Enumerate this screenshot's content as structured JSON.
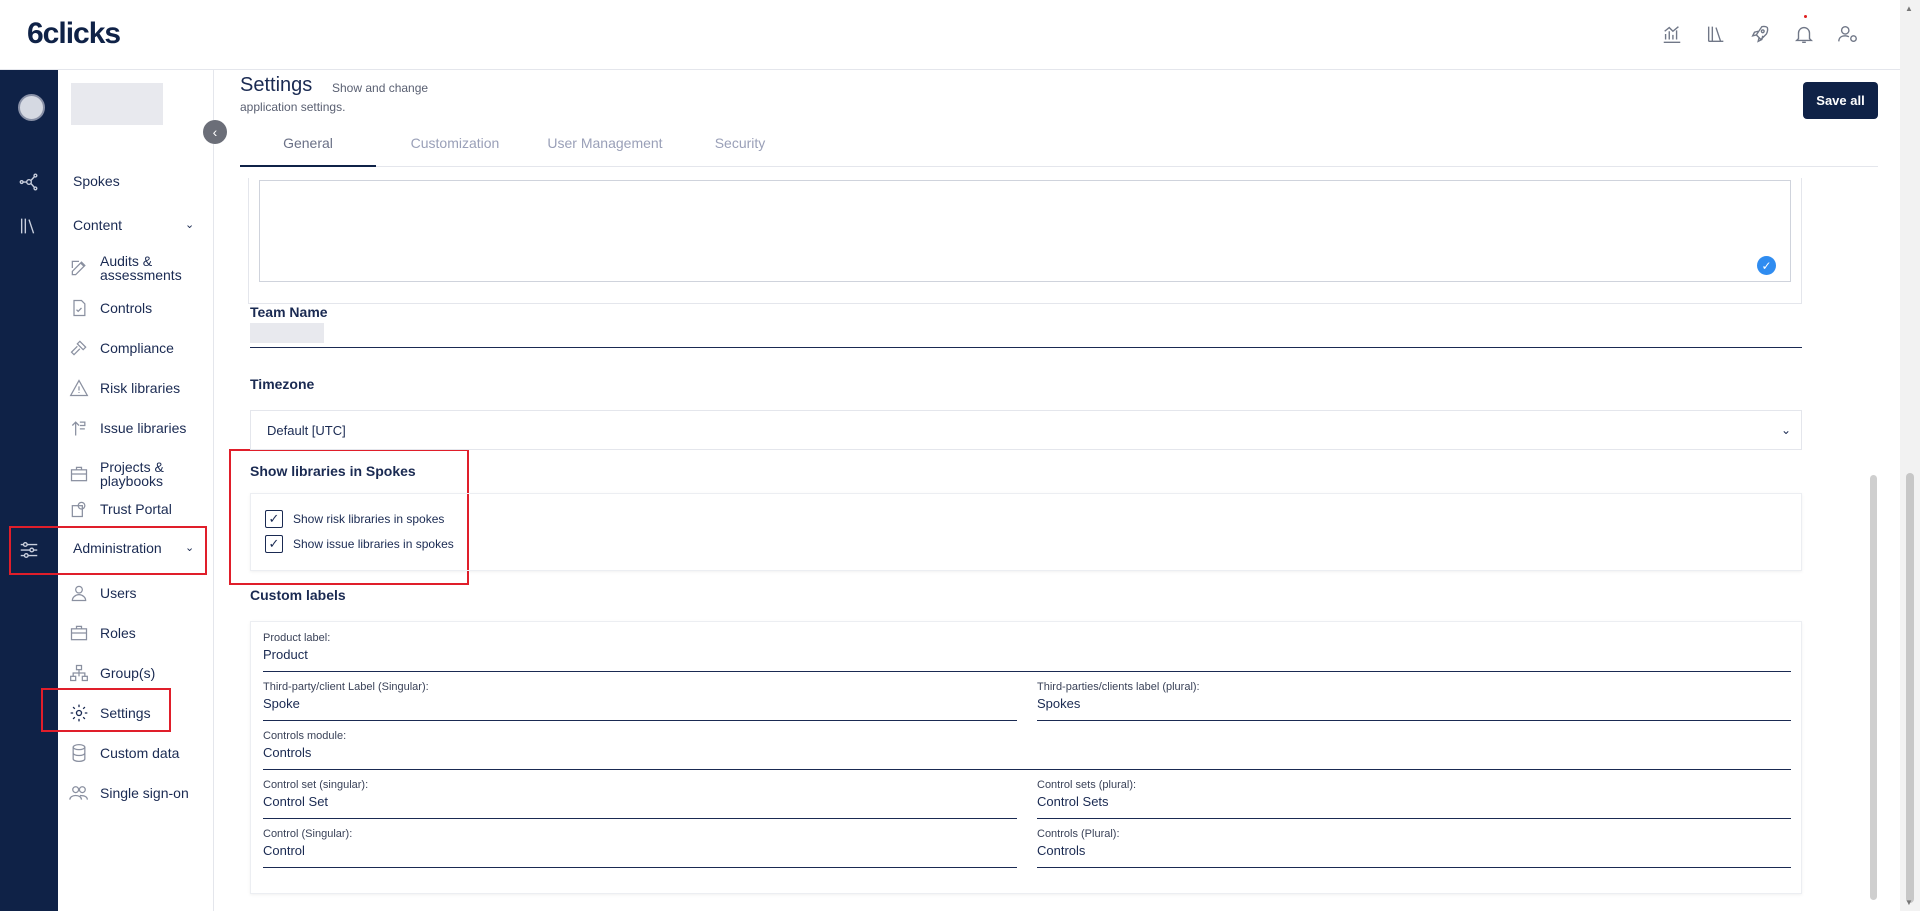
{
  "app": {
    "logo": "6clicks"
  },
  "header_icons": [
    "analytics-icon",
    "library-icon",
    "rocket-icon",
    "bell-icon",
    "user-settings-icon"
  ],
  "sidebar": {
    "spokes": "Spokes",
    "content": "Content",
    "content_items": [
      {
        "label": "Audits & assessments",
        "icon": "edit-icon"
      },
      {
        "label": "Controls",
        "icon": "check-doc-icon"
      },
      {
        "label": "Compliance",
        "icon": "gavel-icon"
      },
      {
        "label": "Risk libraries",
        "icon": "warning-icon"
      },
      {
        "label": "Issue libraries",
        "icon": "issue-icon"
      },
      {
        "label": "Projects & playbooks",
        "icon": "briefcase-icon"
      },
      {
        "label": "Trust Portal",
        "icon": "portal-icon"
      }
    ],
    "administration": "Administration",
    "admin_items": [
      {
        "label": "Users",
        "icon": "user-icon"
      },
      {
        "label": "Roles",
        "icon": "briefcase-icon"
      },
      {
        "label": "Group(s)",
        "icon": "hierarchy-icon"
      },
      {
        "label": "Settings",
        "icon": "gear-icon"
      },
      {
        "label": "Custom data",
        "icon": "database-icon"
      },
      {
        "label": "Single sign-on",
        "icon": "users-icon"
      }
    ]
  },
  "page": {
    "title": "Settings",
    "subtitle_a": "Show and change",
    "subtitle_b": "application settings.",
    "save_label": "Save all",
    "tabs": [
      "General",
      "Customization",
      "User Management",
      "Security"
    ],
    "active_tab": "General"
  },
  "form": {
    "team_name_label": "Team Name",
    "timezone_label": "Timezone",
    "timezone_value": "Default [UTC]",
    "libraries_label": "Show libraries in Spokes",
    "show_risk": "Show risk libraries in spokes",
    "show_issue": "Show issue libraries in spokes",
    "custom_labels_title": "Custom labels",
    "fields": {
      "product_label": {
        "label": "Product label:",
        "value": "Product"
      },
      "third_party_singular": {
        "label": "Third-party/client Label (Singular):",
        "value": "Spoke"
      },
      "third_party_plural": {
        "label": "Third-parties/clients label (plural):",
        "value": "Spokes"
      },
      "controls_module": {
        "label": "Controls module:",
        "value": "Controls"
      },
      "control_set_singular": {
        "label": "Control set (singular):",
        "value": "Control Set"
      },
      "control_sets_plural": {
        "label": "Control sets (plural):",
        "value": "Control Sets"
      },
      "control_singular": {
        "label": "Control (Singular):",
        "value": "Control"
      },
      "controls_plural": {
        "label": "Controls (Plural):",
        "value": "Controls"
      }
    }
  },
  "colors": {
    "brand": "#0f2247",
    "accent": "#2f8cf0",
    "highlight": "#e01e2a"
  }
}
